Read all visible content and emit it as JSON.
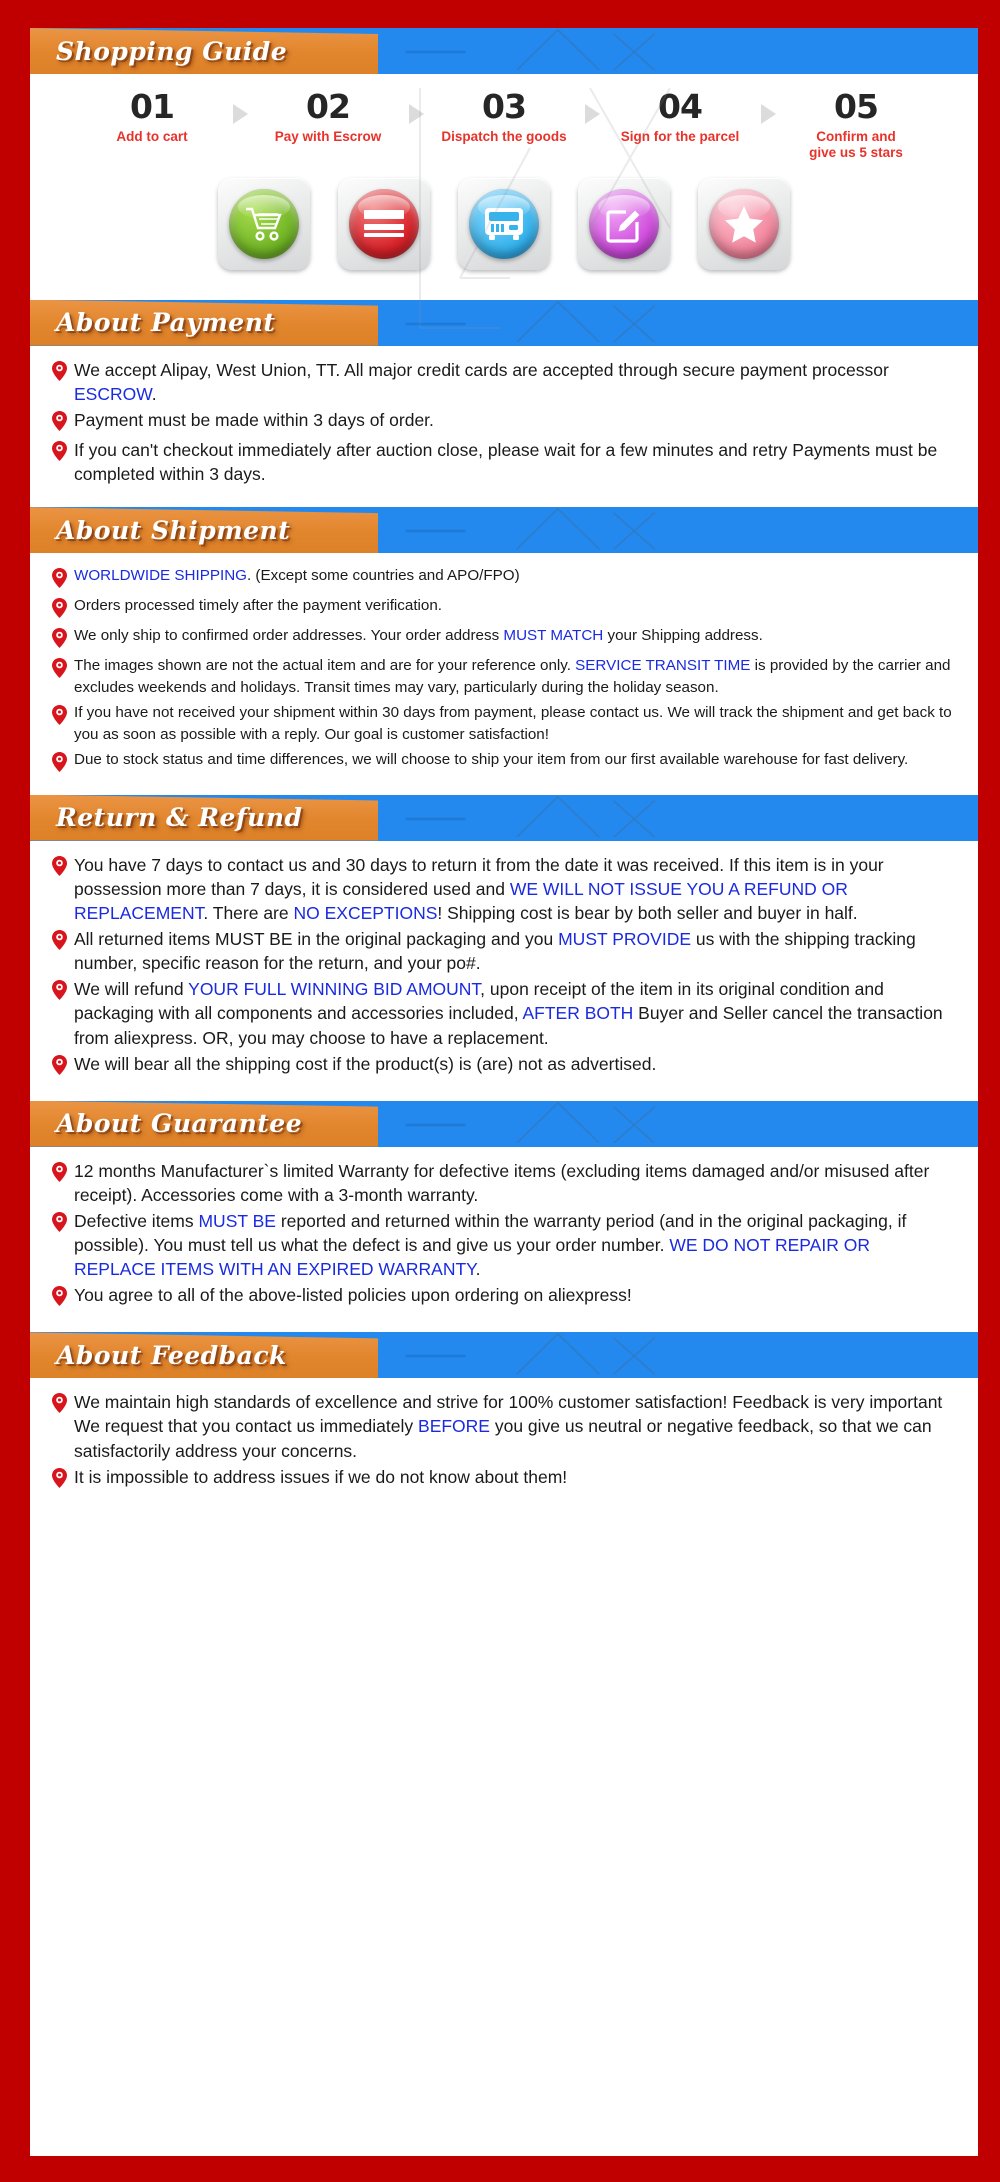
{
  "colors": {
    "page_border": "#c00000",
    "banner_orange": "#e2862d",
    "banner_blue": "#2489ef",
    "step_label_red": "#e8322a",
    "link_blue": "#1a2ae0",
    "pin_red": "#d8141c"
  },
  "guide": {
    "title": "Shopping Guide",
    "steps": [
      {
        "num": "01",
        "label": "Add to cart",
        "icon": "shopping-cart-icon",
        "orb": "orb-green"
      },
      {
        "num": "02",
        "label": "Pay with Escrow",
        "icon": "credit-card-icon",
        "orb": "orb-red"
      },
      {
        "num": "03",
        "label": "Dispatch the goods",
        "icon": "delivery-bus-icon",
        "orb": "orb-blue"
      },
      {
        "num": "04",
        "label": "Sign for the parcel",
        "icon": "edit-pencil-icon",
        "orb": "orb-purple"
      },
      {
        "num": "05",
        "label": "Confirm and\ngive us 5 stars",
        "icon": "star-icon",
        "orb": "orb-pink"
      }
    ]
  },
  "payment": {
    "title": "About Payment",
    "items": [
      [
        {
          "t": "We accept Alipay, West Union, TT. All major credit cards are accepted through secure payment processor "
        },
        {
          "t": "ESCROW",
          "c": "blue"
        },
        {
          "t": "."
        }
      ],
      [
        {
          "t": "Payment must be made within 3 days of order."
        }
      ],
      [
        {
          "t": "If you can't checkout immediately after auction close, please wait for a few minutes and retry Payments must be completed within 3 days."
        }
      ]
    ]
  },
  "shipment": {
    "title": "About Shipment",
    "items": [
      [
        {
          "t": "WORLDWIDE SHIPPING",
          "c": "blue"
        },
        {
          "t": ". (Except some countries and APO/FPO)"
        }
      ],
      [
        {
          "t": "Orders processed timely after the payment verification."
        }
      ],
      [
        {
          "t": "We only ship to confirmed order addresses. Your order address "
        },
        {
          "t": "MUST MATCH",
          "c": "blue"
        },
        {
          "t": " your Shipping address."
        }
      ],
      [
        {
          "t": "The images shown are not the actual item and are for your reference only. "
        },
        {
          "t": "SERVICE TRANSIT TIME",
          "c": "blue"
        },
        {
          "t": " is provided by the carrier and excludes weekends and holidays. Transit times may vary, particularly during the holiday season."
        }
      ],
      [
        {
          "t": "If you have not received your shipment within 30 days from payment, please contact us. We will track the shipment and get back to you as soon as possible with a reply. Our goal is customer satisfaction!"
        }
      ],
      [
        {
          "t": "Due to stock status and time differences, we will choose to ship your item from our first available warehouse for fast delivery."
        }
      ]
    ]
  },
  "returns": {
    "title": "Return & Refund",
    "items": [
      [
        {
          "t": "You have 7 days to contact us and 30 days to return it from the date it was received. If this item is in your possession more than 7 days, it is considered used and "
        },
        {
          "t": "WE WILL NOT ISSUE YOU A REFUND OR REPLACEMENT",
          "c": "blue"
        },
        {
          "t": ". There are "
        },
        {
          "t": "NO EXCEPTIONS",
          "c": "blue"
        },
        {
          "t": "! Shipping cost is bear by both seller and buyer in half."
        }
      ],
      [
        {
          "t": "All returned items MUST BE in the original packaging and you "
        },
        {
          "t": "MUST PROVIDE",
          "c": "blue"
        },
        {
          "t": " us with the shipping tracking number, specific reason for the return, and your po#."
        }
      ],
      [
        {
          "t": "We will refund "
        },
        {
          "t": "YOUR FULL WINNING BID AMOUNT",
          "c": "blue"
        },
        {
          "t": ", upon receipt of the item in its original condition and packaging with all components and accessories included, "
        },
        {
          "t": "AFTER BOTH",
          "c": "blue"
        },
        {
          "t": " Buyer and Seller cancel the transaction from aliexpress. OR, you may choose to have a replacement."
        }
      ],
      [
        {
          "t": "We will bear all the shipping cost if the product(s) is (are) not as advertised."
        }
      ]
    ]
  },
  "guarantee": {
    "title": "About Guarantee",
    "items": [
      [
        {
          "t": "12 months Manufacturer`s limited Warranty for defective items (excluding items damaged and/or misused after receipt). Accessories come with a 3-month warranty."
        }
      ],
      [
        {
          "t": "Defective items "
        },
        {
          "t": "MUST BE",
          "c": "blue"
        },
        {
          "t": " reported and returned within the warranty period (and in the original packaging, if possible). You must tell us what the defect is and give us your order number. "
        },
        {
          "t": "WE DO NOT REPAIR OR REPLACE ITEMS WITH AN EXPIRED WARRANTY",
          "c": "blue"
        },
        {
          "t": "."
        }
      ],
      [
        {
          "t": "You agree to all of the above-listed policies upon ordering on aliexpress!"
        }
      ]
    ]
  },
  "feedback": {
    "title": "About Feedback",
    "items": [
      [
        {
          "t": "We maintain high standards of excellence and strive for 100% customer satisfaction! Feedback is very important We request that you contact us immediately "
        },
        {
          "t": "BEFORE",
          "c": "blue"
        },
        {
          "t": " you give us neutral or negative feedback, so that we can satisfactorily address your concerns."
        }
      ],
      [
        {
          "t": "It is impossible to address issues if we do not know about them!"
        }
      ]
    ]
  }
}
